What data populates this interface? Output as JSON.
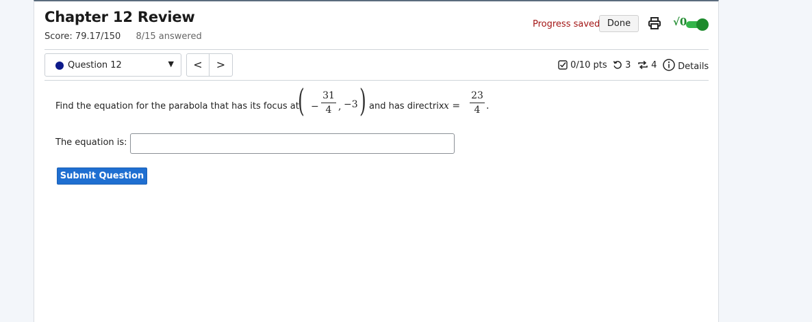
{
  "header": {
    "title": "Chapter 12 Review",
    "score": "Score: 79.17/150",
    "answered": "8/15 answered",
    "progress_status": "Progress saved",
    "done_label": "Done",
    "sqrt_symbol": "√0"
  },
  "question_nav": {
    "selected": "Question 12",
    "prev": "<",
    "next": ">"
  },
  "meta": {
    "points": "0/10 pts",
    "retries": "3",
    "attempts": "4",
    "details": "Details"
  },
  "question": {
    "prompt_start": "Find the equation for the parabola that has its focus at",
    "focus_minus": "−",
    "focus_x_num": "31",
    "focus_x_den": "4",
    "focus_sep": ",",
    "focus_y": "−3",
    "prompt_mid": "and has directrix",
    "directrix_var": "x =",
    "directrix_num": "23",
    "directrix_den": "4",
    "period": ".",
    "answer_label": "The equation is:",
    "answer_value": "",
    "submit_label": "Submit Question"
  },
  "colors": {
    "accent": "#1f6fd1",
    "saved_text": "#a31515",
    "toggle_on": "#34b54a",
    "question_dot": "#0d1a8a"
  }
}
